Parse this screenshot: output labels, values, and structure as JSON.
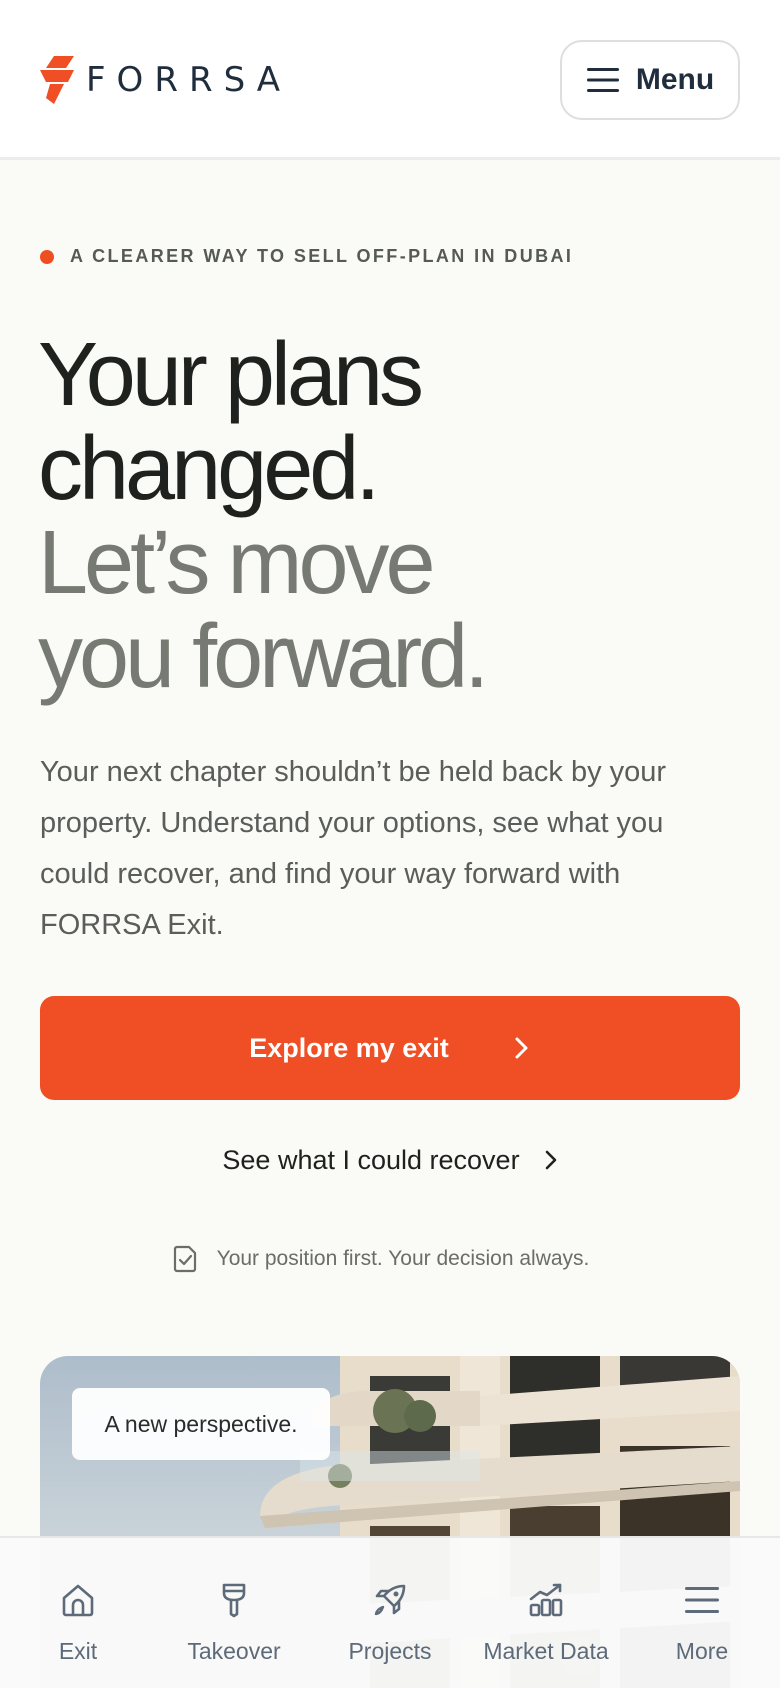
{
  "header": {
    "brand": "FORRSA",
    "menu_label": "Menu",
    "menu_icon": "hamburger-icon"
  },
  "hero": {
    "eyebrow": "A CLEARER WAY TO SELL OFF-PLAN IN DUBAI",
    "headline_line1": "Your plans",
    "headline_line2": "changed.",
    "headline_line3": "Let’s move",
    "headline_line4": "you forward.",
    "lead": "Your next chapter shouldn’t be held back by your property. Understand your options, see what you could recover, and find your way forward with FORRSA Exit.",
    "cta_primary": "Explore my exit",
    "cta_secondary": "See what I could recover",
    "assurance": "Your position first. Your decision always."
  },
  "card": {
    "tag": "A new perspective."
  },
  "bottom_nav": {
    "items": [
      {
        "label": "Exit",
        "icon": "home-icon"
      },
      {
        "label": "Takeover",
        "icon": "key-icon"
      },
      {
        "label": "Projects",
        "icon": "rocket-icon"
      },
      {
        "label": "Market Data",
        "icon": "chart-icon"
      },
      {
        "label": "More",
        "icon": "hamburger-icon"
      }
    ]
  },
  "colors": {
    "accent": "#f04e24",
    "navy": "#1f2d3d",
    "background": "#fafaf7",
    "headline_grey": "#767a72"
  }
}
